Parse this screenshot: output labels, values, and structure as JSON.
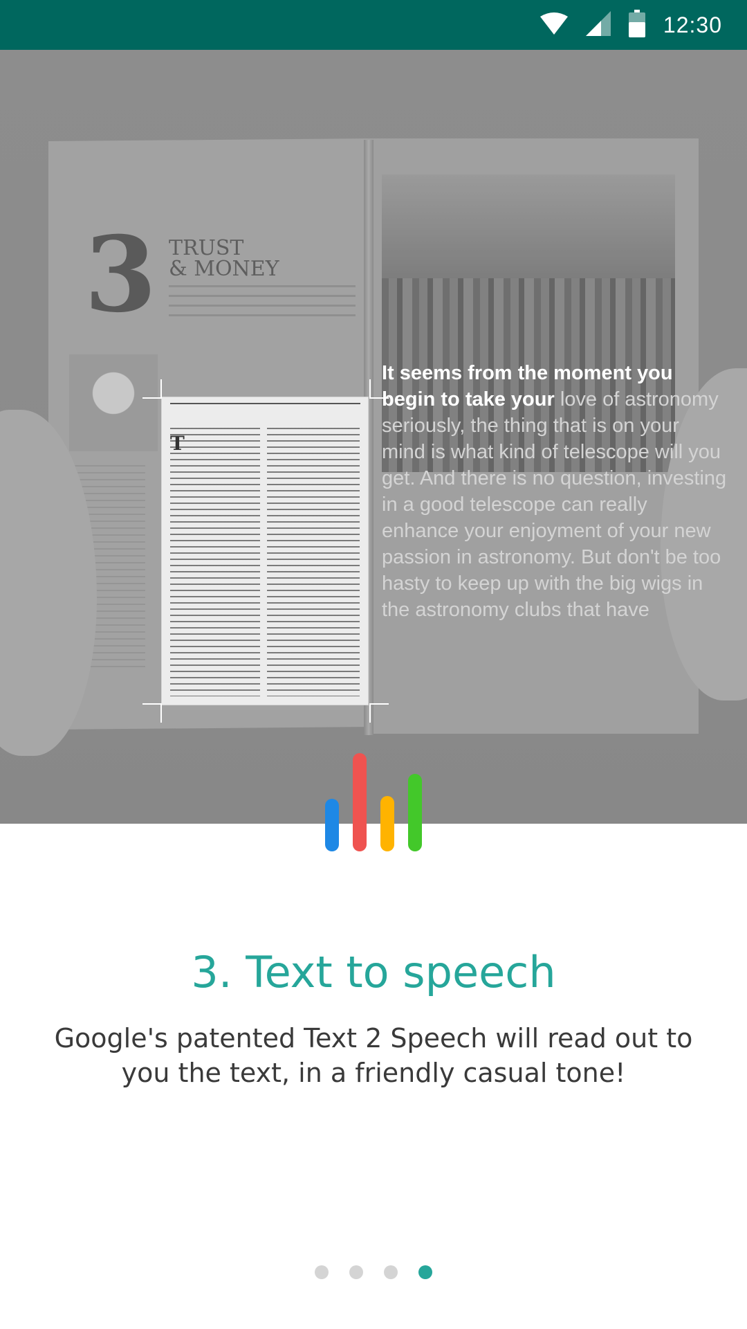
{
  "status_bar": {
    "time": "12:30",
    "icons": [
      "wifi-icon",
      "cell-signal-icon",
      "battery-icon"
    ]
  },
  "hero": {
    "magazine": {
      "page_number": "3",
      "title_lines": [
        "TRUST",
        "& MONEY"
      ]
    },
    "reading_text": {
      "spoken": "It seems from the moment you begin to take your",
      "remaining": " love of astronomy seriously, the thing that is on your mind is what kind of telescope will you get. And there is no question, investing in a good telescope can really enhance your enjoyment of your new passion in astronomy. But don't be too hasty to keep up with the big wigs in the astronomy clubs that have"
    }
  },
  "icon": {
    "name": "speech-bars-icon",
    "bar_colors": [
      "#1e88e5",
      "#ef5350",
      "#ffb300",
      "#43c82a"
    ]
  },
  "onboarding": {
    "title": "3. Text to speech",
    "description": "Google's patented Text 2 Speech will read out to you the text, in a friendly casual tone!"
  },
  "pager": {
    "total": 4,
    "active_index": 3
  },
  "colors": {
    "accent": "#26a69a",
    "status_bar": "#00675e"
  }
}
